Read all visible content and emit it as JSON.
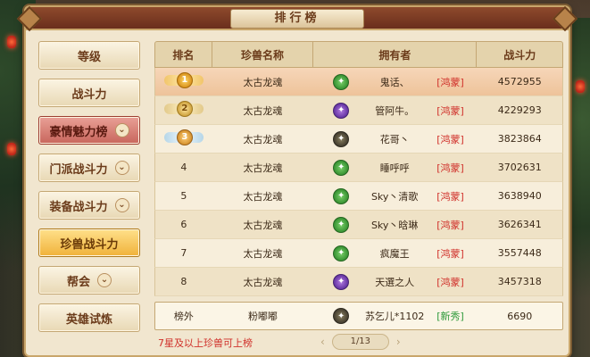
{
  "window": {
    "title": "排行榜"
  },
  "sidebar": {
    "items": [
      {
        "label": "等级",
        "dropdown": false,
        "state": "normal"
      },
      {
        "label": "战斗力",
        "dropdown": false,
        "state": "normal"
      },
      {
        "label": "豪情魅力榜",
        "dropdown": true,
        "state": "active-red"
      },
      {
        "label": "门派战斗力",
        "dropdown": true,
        "state": "normal"
      },
      {
        "label": "装备战斗力",
        "dropdown": true,
        "state": "normal"
      },
      {
        "label": "珍兽战斗力",
        "dropdown": false,
        "state": "active-gold"
      },
      {
        "label": "帮会",
        "dropdown": true,
        "state": "normal"
      },
      {
        "label": "英雄试炼",
        "dropdown": false,
        "state": "normal"
      }
    ],
    "chevron": "⌄"
  },
  "table": {
    "headers": {
      "rank": "排名",
      "pet": "珍兽名称",
      "owner": "拥有者",
      "power": "战斗力"
    },
    "rows": [
      {
        "rank": "1",
        "medal": "gold",
        "pet": "太古龙魂",
        "badge": "green",
        "owner": "鬼话、",
        "guild": "[鸿蒙]",
        "power": "4572955"
      },
      {
        "rank": "2",
        "medal": "silver",
        "pet": "太古龙魂",
        "badge": "purple",
        "owner": "管阿牛。",
        "guild": "[鸿蒙]",
        "power": "4229293"
      },
      {
        "rank": "3",
        "medal": "bronze",
        "pet": "太古龙魂",
        "badge": "dark",
        "owner": "花哥丶",
        "guild": "[鸿蒙]",
        "power": "3823864"
      },
      {
        "rank": "4",
        "medal": "",
        "pet": "太古龙魂",
        "badge": "green",
        "owner": "睡呼呼",
        "guild": "[鸿蒙]",
        "power": "3702631"
      },
      {
        "rank": "5",
        "medal": "",
        "pet": "太古龙魂",
        "badge": "green",
        "owner": "Sky丶清歌",
        "guild": "[鸿蒙]",
        "power": "3638940"
      },
      {
        "rank": "6",
        "medal": "",
        "pet": "太古龙魂",
        "badge": "green",
        "owner": "Sky丶晗琳",
        "guild": "[鸿蒙]",
        "power": "3626341"
      },
      {
        "rank": "7",
        "medal": "",
        "pet": "太古龙魂",
        "badge": "green",
        "owner": "疯魔王",
        "guild": "[鸿蒙]",
        "power": "3557448"
      },
      {
        "rank": "8",
        "medal": "",
        "pet": "太古龙魂",
        "badge": "purple",
        "owner": "天選之人",
        "guild": "[鸿蒙]",
        "power": "3457318"
      }
    ],
    "self_row": {
      "rank": "榜外",
      "pet": "粉嘟嘟",
      "badge": "dark",
      "owner": "苏乞儿*1102",
      "guild": "[新秀]",
      "power": "6690"
    }
  },
  "footer": {
    "note": "7星及以上珍兽可上榜",
    "page": "1/13",
    "prev": "‹",
    "next": "›"
  },
  "colors": {
    "guild_red": "#d0302a",
    "guild_green": "#2e9a3a",
    "active_red": "#c8665c",
    "active_gold": "#f0b23a"
  }
}
